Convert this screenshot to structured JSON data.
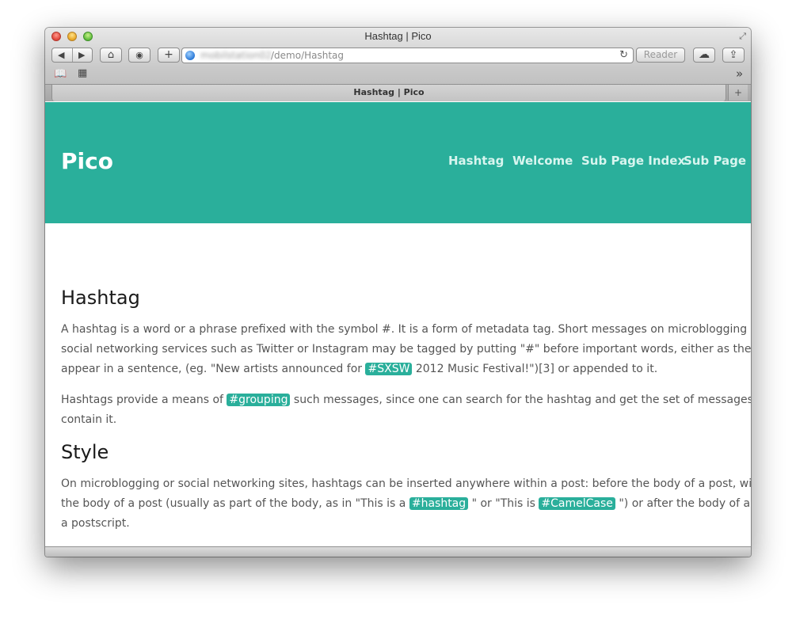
{
  "window": {
    "title": "Hashtag | Pico"
  },
  "toolbar": {
    "back_icon": "◀",
    "forward_icon": "▶",
    "home_icon": "⌂",
    "shield_icon": "◉",
    "add_icon": "+",
    "url_host": "mobilstation02",
    "url_path": "/demo/Hashtag",
    "reload_icon": "↻",
    "reader_label": "Reader",
    "cloud_icon": "☁",
    "share_icon": "⇪"
  },
  "bookmarks": {
    "book_icon": "📖",
    "grid_icon": "▦",
    "more_icon": "»"
  },
  "tab": {
    "title": "Hashtag | Pico",
    "new_tab_icon": "+"
  },
  "site": {
    "title": "Pico",
    "nav": [
      "Hashtag",
      "Welcome",
      "Sub Page Index",
      "Sub Page"
    ]
  },
  "article": {
    "heading1": "Hashtag",
    "p1_line1": "A hashtag is a word or a phrase prefixed with the symbol #. It is a form of metadata tag. Short messages on microblogging and",
    "p1_line2": "social networking services such as Twitter or Instagram may be tagged by putting \"#\" before important words, either as they",
    "p1_line3_a": "appear in a sentence, (eg. \"New artists announced for ",
    "p1_tag": "#SXSW",
    "p1_line3_b": " 2012 Music Festival!\")[3] or appended to it.",
    "p2_line1_a": "Hashtags provide a means of ",
    "p2_tag": "#grouping",
    "p2_line1_b": " such messages, since one can search for the hashtag and get the set of messages that",
    "p2_line2": "contain it.",
    "heading2": "Style",
    "p3_line1": "On microblogging or social networking sites, hashtags can be inserted anywhere within a post: before the body of a post, within",
    "p3_line2_a": "the body of a post (usually as part of the body, as in \"This is a ",
    "p3_tag1": "#hashtag",
    "p3_line2_b": " \" or \"This is ",
    "p3_tag2": "#CamelCase",
    "p3_line2_c": " \") or after the body of a post as",
    "p3_line3": "a postscript."
  },
  "colors": {
    "accent": "#2aaf9b",
    "nav_text": "#d8f5ef"
  }
}
